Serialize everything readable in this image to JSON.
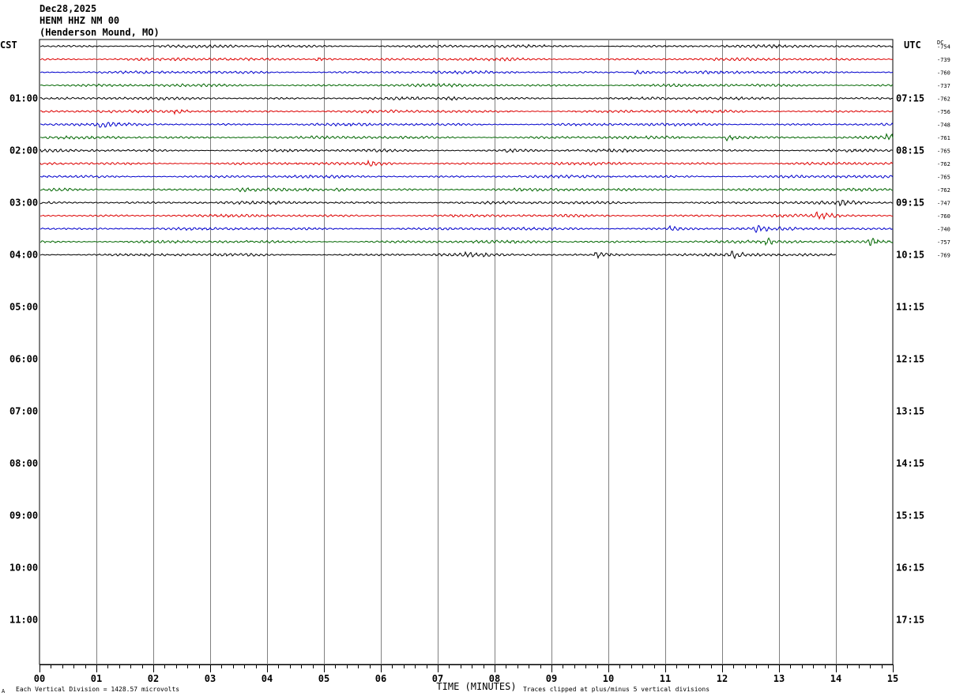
{
  "header": {
    "date": "Dec28,2025",
    "station": "HENM HHZ NM 00",
    "location": "(Henderson Mound, MO)"
  },
  "chart_data": {
    "type": "line",
    "title": "HENM HHZ NM 00",
    "left_axis_label": "CST",
    "right_axis_label": "UTC",
    "dc_label": "DC",
    "xlabel": "TIME (MINUTES)",
    "xlim": [
      0,
      15
    ],
    "x_ticks": [
      "00",
      "01",
      "02",
      "03",
      "04",
      "05",
      "06",
      "07",
      "08",
      "09",
      "10",
      "11",
      "12",
      "13",
      "14",
      "15"
    ],
    "left_hour_labels": [
      "01:00",
      "02:00",
      "03:00",
      "04:00",
      "05:00",
      "06:00",
      "07:00",
      "08:00",
      "09:00",
      "10:00",
      "11:00"
    ],
    "right_hour_labels": [
      "07:15",
      "08:15",
      "09:15",
      "10:15",
      "11:15",
      "12:15",
      "13:15",
      "14:15",
      "15:15",
      "16:15",
      "17:15"
    ],
    "rows_per_hour": 4,
    "total_rows": 48,
    "first_row_time_cst": "00:15",
    "trace_colors": [
      "#000000",
      "#dd0000",
      "#0000cc",
      "#006600"
    ],
    "dc_offsets": [
      -754,
      -739,
      -760,
      -737,
      -762,
      -756,
      -748,
      -761,
      -765,
      -762,
      -765,
      -762,
      -747,
      -760,
      -740,
      -757,
      -769
    ],
    "last_trace_end_minute": 14.0,
    "traces": [
      {
        "events": []
      },
      {
        "events": [
          {
            "t": 4.9,
            "a": 1.4
          }
        ]
      },
      {
        "events": [
          {
            "t": 10.5,
            "a": 1.5
          }
        ]
      },
      {
        "events": []
      },
      {
        "events": [
          {
            "t": 7.2,
            "a": 1.2
          }
        ]
      },
      {
        "events": [
          {
            "t": 2.4,
            "a": 1.3
          }
        ]
      },
      {
        "events": [
          {
            "t": 1.1,
            "a": 1.7
          }
        ]
      },
      {
        "events": [
          {
            "t": 12.1,
            "a": 2.4
          },
          {
            "t": 14.9,
            "a": 2.0
          }
        ]
      },
      {
        "events": [
          {
            "t": 8.2,
            "a": 1.3
          }
        ]
      },
      {
        "events": [
          {
            "t": 5.8,
            "a": 1.4
          }
        ]
      },
      {
        "events": []
      },
      {
        "events": [
          {
            "t": 3.5,
            "a": 1.3
          },
          {
            "t": 5.2,
            "a": 1.3
          }
        ]
      },
      {
        "events": [
          {
            "t": 14.1,
            "a": 1.6
          }
        ]
      },
      {
        "events": [
          {
            "t": 13.7,
            "a": 2.4
          }
        ]
      },
      {
        "events": [
          {
            "t": 11.1,
            "a": 1.6
          },
          {
            "t": 12.6,
            "a": 2.0
          }
        ]
      },
      {
        "events": [
          {
            "t": 12.8,
            "a": 2.2
          },
          {
            "t": 14.6,
            "a": 3.2
          }
        ]
      },
      {
        "events": [
          {
            "t": 7.5,
            "a": 1.3
          },
          {
            "t": 9.8,
            "a": 2.6
          },
          {
            "t": 12.2,
            "a": 2.4
          }
        ]
      }
    ],
    "footer_left": "Each Vertical Division = 1428.57 microvolts",
    "footer_right": "Traces clipped at plus/minus 5 vertical divisions",
    "footer_mark": "A"
  }
}
